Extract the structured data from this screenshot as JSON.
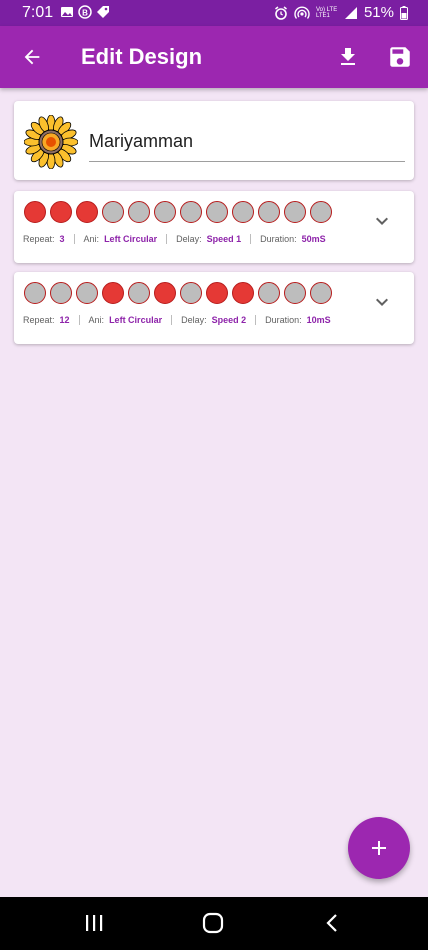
{
  "status_bar": {
    "time": "7:01",
    "battery": "51%",
    "network": "Vo) LTE\nLTE1"
  },
  "app_bar": {
    "title": "Edit Design",
    "back_icon": "arrow-back-icon",
    "download_icon": "download-icon",
    "save_icon": "save-icon"
  },
  "design": {
    "name": "Mariyamman",
    "avatar_icon": "sunflower-icon"
  },
  "patterns": [
    {
      "dots": [
        1,
        1,
        1,
        0,
        0,
        0,
        0,
        0,
        0,
        0,
        0,
        0
      ],
      "repeat_label": "Repeat:",
      "repeat": "3",
      "ani_label": "Ani:",
      "ani": "Left Circular",
      "delay_label": "Delay:",
      "delay": "Speed 1",
      "duration_label": "Duration:",
      "duration": "50mS"
    },
    {
      "dots": [
        0,
        0,
        0,
        1,
        0,
        1,
        0,
        1,
        1,
        0,
        0,
        0
      ],
      "repeat_label": "Repeat:",
      "repeat": "12",
      "ani_label": "Ani:",
      "ani": "Left Circular",
      "delay_label": "Delay:",
      "delay": "Speed 2",
      "duration_label": "Duration:",
      "duration": "10mS"
    }
  ],
  "fab_icon": "add-icon",
  "colors": {
    "primary": "#9c27b0",
    "primary_dark": "#7b1fa2",
    "background": "#f3e5f5",
    "dot_on": "#e53935",
    "dot_off": "#bdbdbd",
    "value_text": "#8e24aa"
  }
}
